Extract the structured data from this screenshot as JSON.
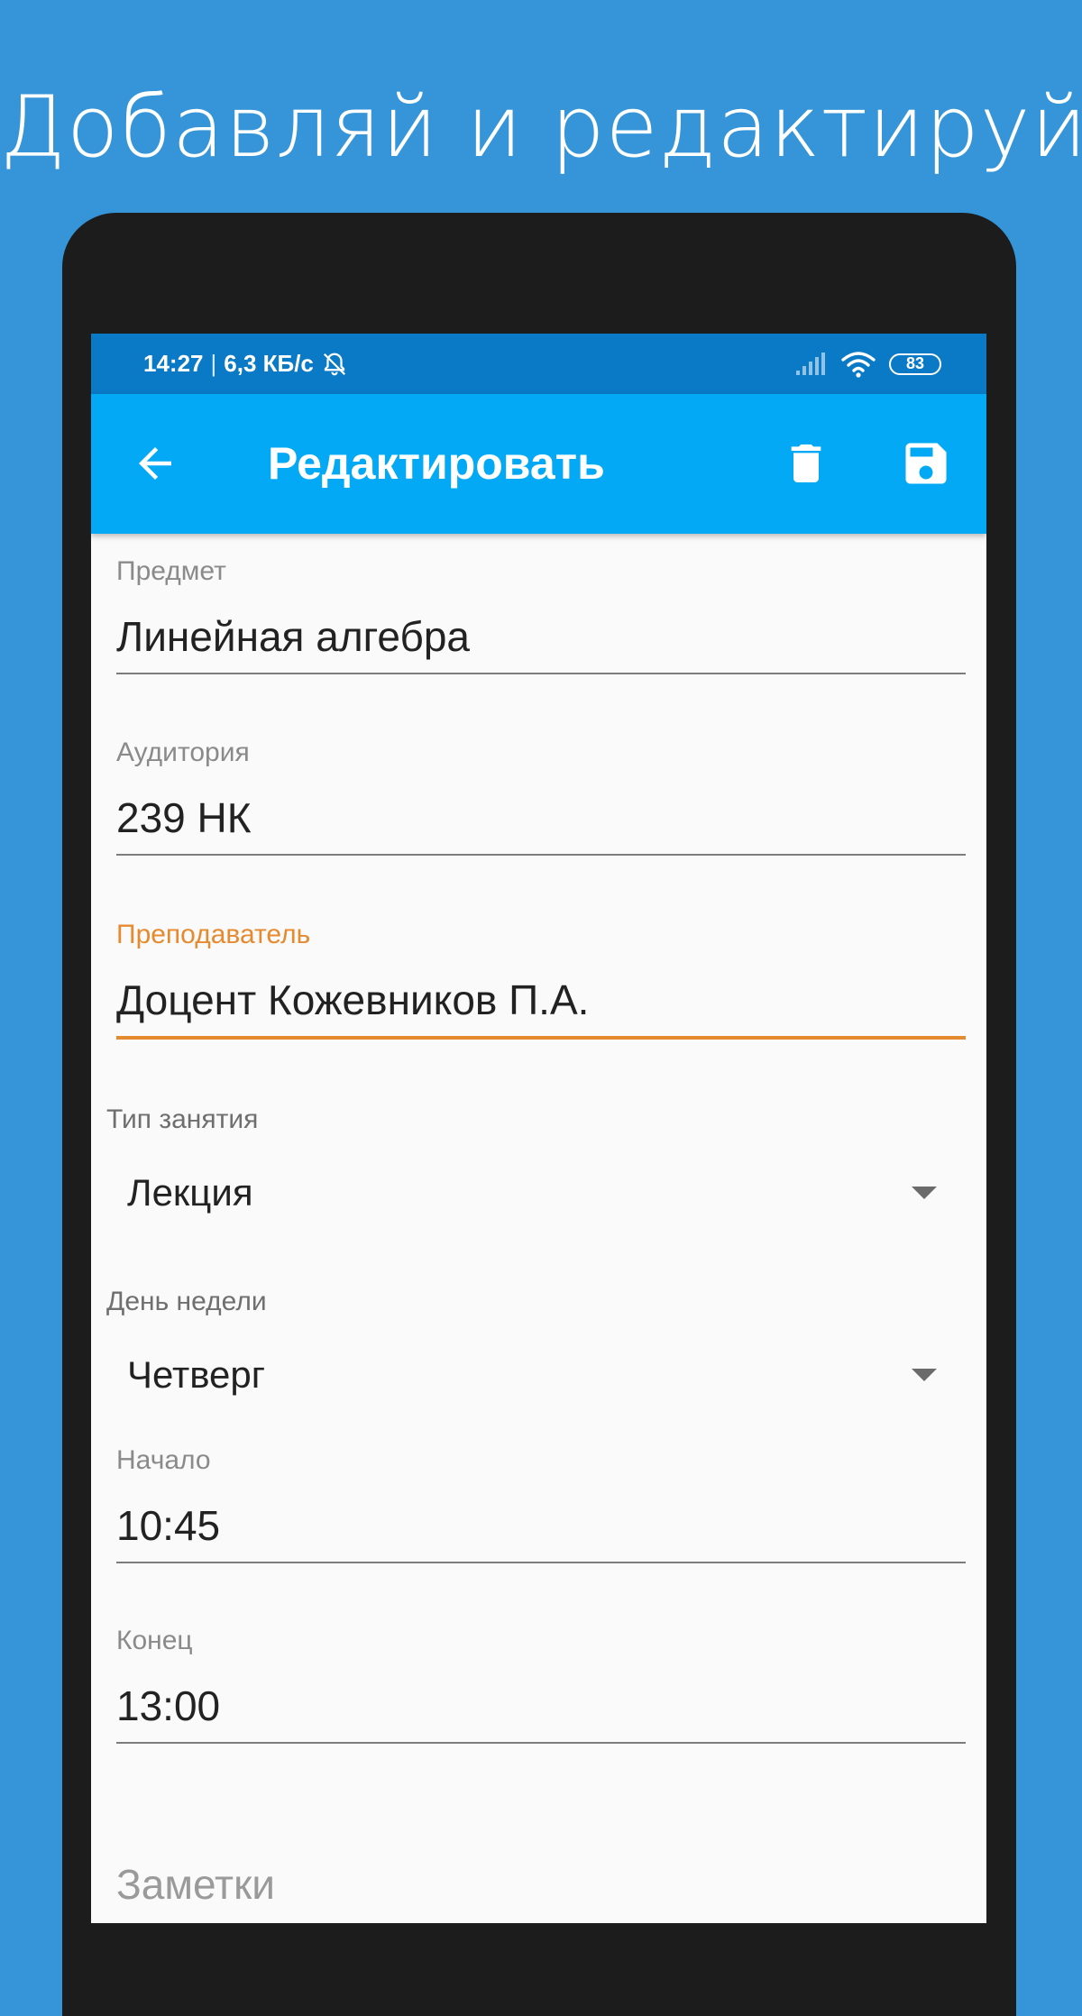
{
  "promo": {
    "title": "Добавляй и редактируй"
  },
  "status_bar": {
    "time": "14:27",
    "separator": "|",
    "speed": "6,3 КБ/с",
    "battery": "83",
    "icons": [
      "alarm-off-icon",
      "signal-icon",
      "wifi-icon",
      "battery-icon"
    ]
  },
  "app_bar": {
    "title": "Редактировать",
    "back_icon": "arrow-back-icon",
    "delete_icon": "delete-icon",
    "save_icon": "save-icon"
  },
  "form": {
    "subject": {
      "label": "Предмет",
      "value": "Линейная алгебра"
    },
    "room": {
      "label": "Аудитория",
      "value": "239 НК"
    },
    "teacher": {
      "label": "Преподаватель",
      "value": "Доцент Кожевников П.А.",
      "focused": true
    },
    "lesson_type": {
      "label": "Тип занятия",
      "value": "Лекция"
    },
    "weekday": {
      "label": "День недели",
      "value": "Четверг"
    },
    "start": {
      "label": "Начало",
      "value": "10:45"
    },
    "end": {
      "label": "Конец",
      "value": "13:00"
    },
    "notes": {
      "placeholder": "Заметки",
      "value": ""
    }
  },
  "colors": {
    "background": "#3595d8",
    "status_bar": "#0a7ac6",
    "app_bar": "#03a9f4",
    "accent": "#e58a2e",
    "phone_frame": "#1c1c1c",
    "screen": "#fafafa"
  }
}
